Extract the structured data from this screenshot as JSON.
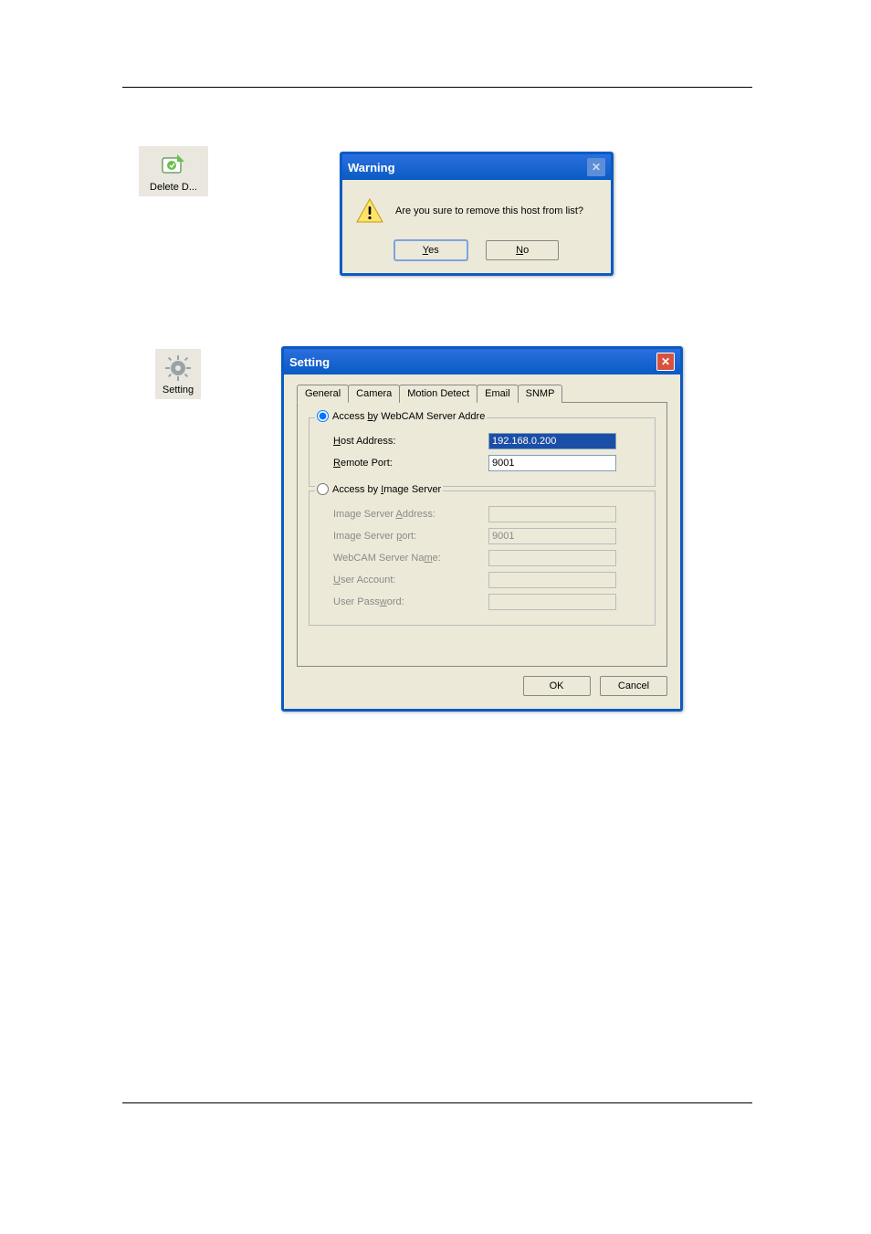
{
  "deleteIcon": {
    "label": "Delete D..."
  },
  "settingIcon": {
    "label": "Setting"
  },
  "warningDialog": {
    "title": "Warning",
    "message": "Are you sure to remove this host from list?",
    "yesPrefix": "Y",
    "yesRest": "es",
    "noPrefix": "N",
    "noRest": "o"
  },
  "settingDialog": {
    "title": "Setting",
    "tabs": {
      "general": "General",
      "camera": "Camera",
      "motion": "Motion Detect",
      "email": "Email",
      "snmp": "SNMP"
    },
    "group1": {
      "legendPre": "Access ",
      "legendU": "b",
      "legendPost": "y WebCAM Server Addre",
      "hostPre": "H",
      "hostRest": "ost Address:",
      "hostValue": "192.168.0.200",
      "remotePre": "R",
      "remoteRest": "emote Port:",
      "remoteValue": "9001"
    },
    "group2": {
      "legendPre": "Access by ",
      "legendU": "I",
      "legendPost": "mage Server",
      "imgAddrPre": "Image Server ",
      "imgAddrU": "A",
      "imgAddrPost": "ddress:",
      "imgAddrValue": "",
      "imgPortPre": "Image Server ",
      "imgPortU": "p",
      "imgPortPost": "ort:",
      "imgPortValue": "9001",
      "nameLabelPre": "WebCAM Server Na",
      "nameLabelU": "m",
      "nameLabelPost": "e:",
      "nameValue": "",
      "userLabelU": "U",
      "userLabelRest": "ser Account:",
      "userValue": "",
      "passLabelPre": "User Pass",
      "passLabelU": "w",
      "passLabelPost": "ord:",
      "passValue": ""
    },
    "okLabel": "OK",
    "cancelLabel": "Cancel"
  }
}
